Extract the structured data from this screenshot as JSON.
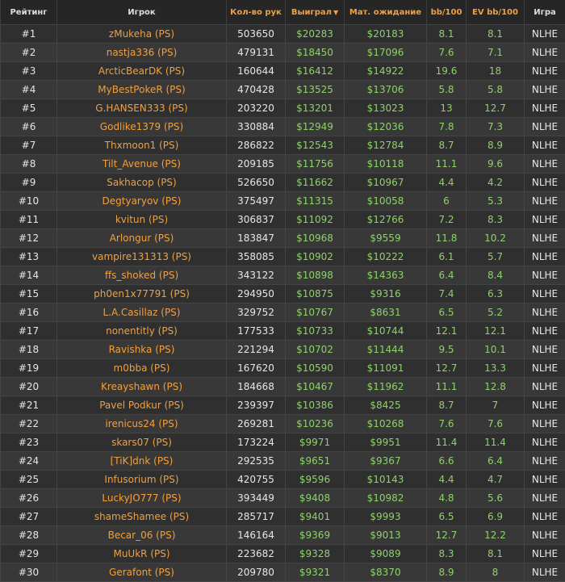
{
  "table": {
    "headers": {
      "rank": "Рейтинг",
      "player": "Игрок",
      "hands": "Кол-во рук",
      "won": "Выиграл",
      "expected": "Мат. ожидание",
      "bb100": "bb/100",
      "ev_bb100": "EV bb/100",
      "game": "Игра"
    },
    "sort_column": "won",
    "sort_direction": "descending",
    "colors": {
      "player_link": "#f0a040",
      "money": "#8fd16a",
      "header_active": "#f0a040"
    },
    "rows": [
      {
        "rank": "#1",
        "player": "zMukeha (PS)",
        "hands": "503650",
        "won": "$20283",
        "expected": "$20183",
        "bb100": "8.1",
        "ev_bb100": "8.1",
        "game": "NLHE"
      },
      {
        "rank": "#2",
        "player": "nastja336 (PS)",
        "hands": "479131",
        "won": "$18450",
        "expected": "$17096",
        "bb100": "7.6",
        "ev_bb100": "7.1",
        "game": "NLHE"
      },
      {
        "rank": "#3",
        "player": "ArcticBearDK (PS)",
        "hands": "160644",
        "won": "$16412",
        "expected": "$14922",
        "bb100": "19.6",
        "ev_bb100": "18",
        "game": "NLHE"
      },
      {
        "rank": "#4",
        "player": "MyBestPokeR (PS)",
        "hands": "470428",
        "won": "$13525",
        "expected": "$13706",
        "bb100": "5.8",
        "ev_bb100": "5.8",
        "game": "NLHE"
      },
      {
        "rank": "#5",
        "player": "G.HANSEN333 (PS)",
        "hands": "203220",
        "won": "$13201",
        "expected": "$13023",
        "bb100": "13",
        "ev_bb100": "12.7",
        "game": "NLHE"
      },
      {
        "rank": "#6",
        "player": "Godlike1379 (PS)",
        "hands": "330884",
        "won": "$12949",
        "expected": "$12036",
        "bb100": "7.8",
        "ev_bb100": "7.3",
        "game": "NLHE"
      },
      {
        "rank": "#7",
        "player": "Thxmoon1 (PS)",
        "hands": "286822",
        "won": "$12543",
        "expected": "$12784",
        "bb100": "8.7",
        "ev_bb100": "8.9",
        "game": "NLHE"
      },
      {
        "rank": "#8",
        "player": "Tilt_Avenue (PS)",
        "hands": "209185",
        "won": "$11756",
        "expected": "$10118",
        "bb100": "11.1",
        "ev_bb100": "9.6",
        "game": "NLHE"
      },
      {
        "rank": "#9",
        "player": "Sakhacop (PS)",
        "hands": "526650",
        "won": "$11662",
        "expected": "$10967",
        "bb100": "4.4",
        "ev_bb100": "4.2",
        "game": "NLHE"
      },
      {
        "rank": "#10",
        "player": "Degtyaryov (PS)",
        "hands": "375497",
        "won": "$11315",
        "expected": "$10058",
        "bb100": "6",
        "ev_bb100": "5.3",
        "game": "NLHE"
      },
      {
        "rank": "#11",
        "player": "kvitun (PS)",
        "hands": "306837",
        "won": "$11092",
        "expected": "$12766",
        "bb100": "7.2",
        "ev_bb100": "8.3",
        "game": "NLHE"
      },
      {
        "rank": "#12",
        "player": "Arlongur (PS)",
        "hands": "183847",
        "won": "$10968",
        "expected": "$9559",
        "bb100": "11.8",
        "ev_bb100": "10.2",
        "game": "NLHE"
      },
      {
        "rank": "#13",
        "player": "vampire131313 (PS)",
        "hands": "358085",
        "won": "$10902",
        "expected": "$10222",
        "bb100": "6.1",
        "ev_bb100": "5.7",
        "game": "NLHE"
      },
      {
        "rank": "#14",
        "player": "ffs_shoked (PS)",
        "hands": "343122",
        "won": "$10898",
        "expected": "$14363",
        "bb100": "6.4",
        "ev_bb100": "8.4",
        "game": "NLHE"
      },
      {
        "rank": "#15",
        "player": "ph0en1x77791 (PS)",
        "hands": "294950",
        "won": "$10875",
        "expected": "$9316",
        "bb100": "7.4",
        "ev_bb100": "6.3",
        "game": "NLHE"
      },
      {
        "rank": "#16",
        "player": "L.A.Casillaz (PS)",
        "hands": "329752",
        "won": "$10767",
        "expected": "$8631",
        "bb100": "6.5",
        "ev_bb100": "5.2",
        "game": "NLHE"
      },
      {
        "rank": "#17",
        "player": "nonentitly (PS)",
        "hands": "177533",
        "won": "$10733",
        "expected": "$10744",
        "bb100": "12.1",
        "ev_bb100": "12.1",
        "game": "NLHE"
      },
      {
        "rank": "#18",
        "player": "Ravishka (PS)",
        "hands": "221294",
        "won": "$10702",
        "expected": "$11444",
        "bb100": "9.5",
        "ev_bb100": "10.1",
        "game": "NLHE"
      },
      {
        "rank": "#19",
        "player": "m0bba (PS)",
        "hands": "167620",
        "won": "$10590",
        "expected": "$11091",
        "bb100": "12.7",
        "ev_bb100": "13.3",
        "game": "NLHE"
      },
      {
        "rank": "#20",
        "player": "Kreayshawn (PS)",
        "hands": "184668",
        "won": "$10467",
        "expected": "$11962",
        "bb100": "11.1",
        "ev_bb100": "12.8",
        "game": "NLHE"
      },
      {
        "rank": "#21",
        "player": "Pavel Podkur (PS)",
        "hands": "239397",
        "won": "$10386",
        "expected": "$8425",
        "bb100": "8.7",
        "ev_bb100": "7",
        "game": "NLHE"
      },
      {
        "rank": "#22",
        "player": "irenicus24 (PS)",
        "hands": "269281",
        "won": "$10236",
        "expected": "$10268",
        "bb100": "7.6",
        "ev_bb100": "7.6",
        "game": "NLHE"
      },
      {
        "rank": "#23",
        "player": "skars07 (PS)",
        "hands": "173224",
        "won": "$9971",
        "expected": "$9951",
        "bb100": "11.4",
        "ev_bb100": "11.4",
        "game": "NLHE"
      },
      {
        "rank": "#24",
        "player": "[TiK]dnk (PS)",
        "hands": "292535",
        "won": "$9651",
        "expected": "$9367",
        "bb100": "6.6",
        "ev_bb100": "6.4",
        "game": "NLHE"
      },
      {
        "rank": "#25",
        "player": "Infusorium (PS)",
        "hands": "420755",
        "won": "$9596",
        "expected": "$10143",
        "bb100": "4.4",
        "ev_bb100": "4.7",
        "game": "NLHE"
      },
      {
        "rank": "#26",
        "player": "LuckyJO777 (PS)",
        "hands": "393449",
        "won": "$9408",
        "expected": "$10982",
        "bb100": "4.8",
        "ev_bb100": "5.6",
        "game": "NLHE"
      },
      {
        "rank": "#27",
        "player": "shameShamee (PS)",
        "hands": "285717",
        "won": "$9401",
        "expected": "$9993",
        "bb100": "6.5",
        "ev_bb100": "6.9",
        "game": "NLHE"
      },
      {
        "rank": "#28",
        "player": "Becar_06 (PS)",
        "hands": "146164",
        "won": "$9369",
        "expected": "$9013",
        "bb100": "12.7",
        "ev_bb100": "12.2",
        "game": "NLHE"
      },
      {
        "rank": "#29",
        "player": "MuUkR (PS)",
        "hands": "223682",
        "won": "$9328",
        "expected": "$9089",
        "bb100": "8.3",
        "ev_bb100": "8.1",
        "game": "NLHE"
      },
      {
        "rank": "#30",
        "player": "Gerafont (PS)",
        "hands": "209780",
        "won": "$9321",
        "expected": "$8370",
        "bb100": "8.9",
        "ev_bb100": "8",
        "game": "NLHE"
      }
    ]
  }
}
